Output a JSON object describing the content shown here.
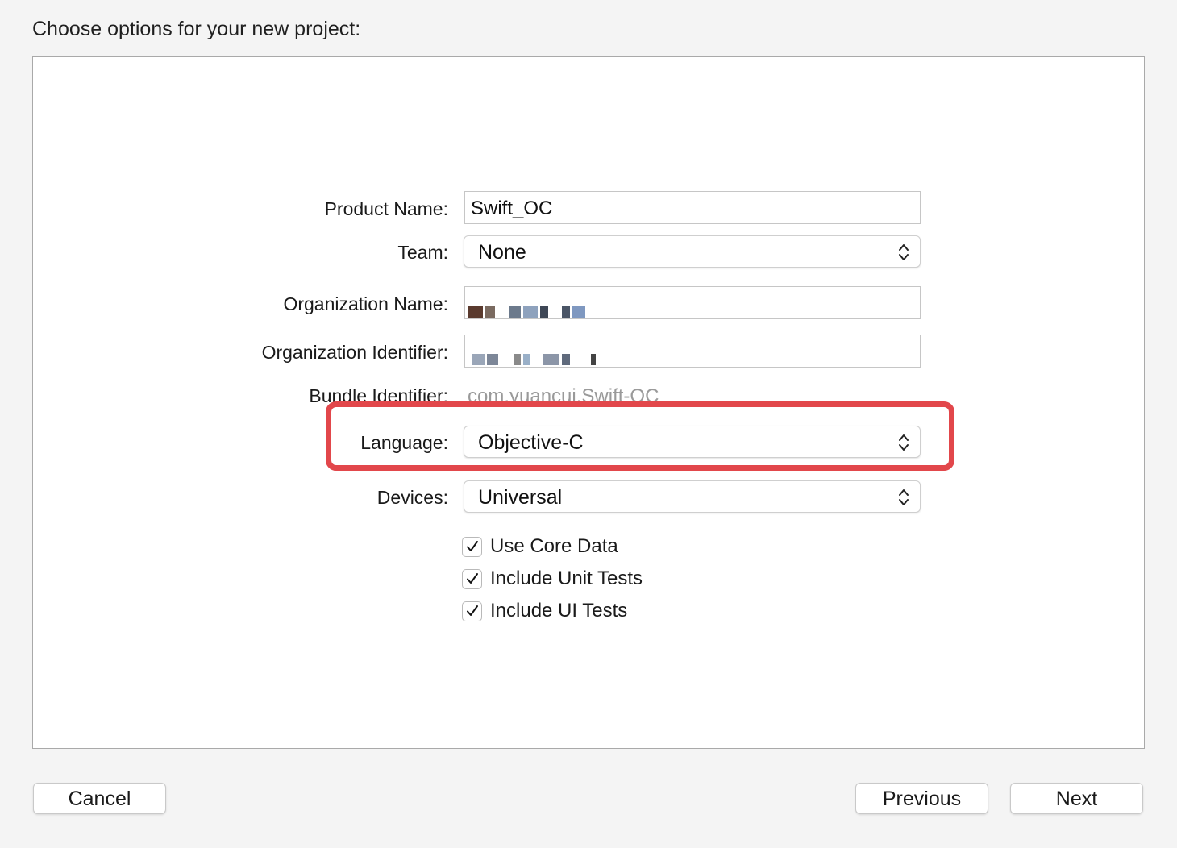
{
  "page": {
    "heading": "Choose options for your new project:"
  },
  "form": {
    "product_name": {
      "label": "Product Name:",
      "value": "Swift_OC"
    },
    "team": {
      "label": "Team:",
      "value": "None"
    },
    "organization_name": {
      "label": "Organization Name:"
    },
    "organization_identifier": {
      "label": "Organization Identifier:"
    },
    "bundle_identifier": {
      "label": "Bundle Identifier:",
      "value": "com.yuancui.Swift-OC"
    },
    "language": {
      "label": "Language:",
      "value": "Objective-C"
    },
    "devices": {
      "label": "Devices:",
      "value": "Universal"
    },
    "options": [
      {
        "label": "Use Core Data",
        "checked": true
      },
      {
        "label": "Include Unit Tests",
        "checked": true
      },
      {
        "label": "Include UI Tests",
        "checked": true
      }
    ]
  },
  "buttons": {
    "cancel": "Cancel",
    "previous": "Previous",
    "next": "Next"
  },
  "colors": {
    "highlight": "#e2474b",
    "panel_border": "#a9a9a9",
    "placeholder_text": "#9a9a9a"
  },
  "icons": {
    "popup_arrows": "up-down-chevron-icon",
    "checkbox": "checkmark-icon"
  }
}
